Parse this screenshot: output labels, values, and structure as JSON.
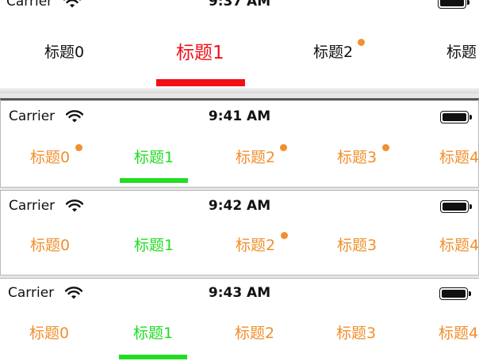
{
  "colors": {
    "selected_red": "#f20f18",
    "selected_green": "#22dd22",
    "normal_orange": "#f0902e",
    "normal_black": "#111111",
    "badge": "#f0902e"
  },
  "status": {
    "carrier": "Carrier",
    "wifi_icon": "wifi-icon",
    "battery_icon": "battery-icon"
  },
  "panels": [
    {
      "time": "9:37 AM",
      "selected_index": 1,
      "tabs": [
        {
          "label": "标题0"
        },
        {
          "label": "标题1"
        },
        {
          "label": "标题2",
          "badge": true
        },
        {
          "label": "标题"
        }
      ]
    },
    {
      "time": "9:41 AM",
      "selected_index": 1,
      "tabs": [
        {
          "label": "标题0",
          "badge": true
        },
        {
          "label": "标题1"
        },
        {
          "label": "标题2",
          "badge": true
        },
        {
          "label": "标题3",
          "badge": true
        },
        {
          "label": "标题4"
        }
      ]
    },
    {
      "time": "9:42 AM",
      "selected_index": 1,
      "tabs": [
        {
          "label": "标题0"
        },
        {
          "label": "标题1"
        },
        {
          "label": "标题2",
          "badge": true
        },
        {
          "label": "标题3"
        },
        {
          "label": "标题4"
        }
      ]
    },
    {
      "time": "9:43 AM",
      "selected_index": 1,
      "tabs": [
        {
          "label": "标题0"
        },
        {
          "label": "标题1"
        },
        {
          "label": "标题2"
        },
        {
          "label": "标题3"
        },
        {
          "label": "标题4"
        }
      ]
    }
  ]
}
